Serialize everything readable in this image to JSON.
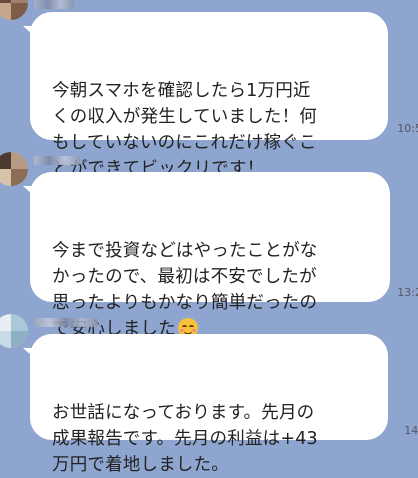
{
  "messages": [
    {
      "text": "今朝スマホを確認したら1万円近\nくの収入が発生していました！何\nもしていないのにこれだけ稼ぐこ\nとができてビックリです！",
      "time": "10:5"
    },
    {
      "text": "今まで投資などはやったことがな\nかったので、最初は不安でしたが\n思ったよりもかなり簡単だったの\nで安心しました",
      "emoji": "smiling-face-with-smiling-eyes",
      "time": "13:2"
    },
    {
      "text": "お世話になっております。先月の\n成果報告です。先月の利益は+43\n万円で着地しました。",
      "time": "14:"
    }
  ],
  "colors": {
    "background": "#8ea6cf",
    "bubble": "#ffffff",
    "text": "#222222",
    "emoji": "#f7c23a"
  }
}
